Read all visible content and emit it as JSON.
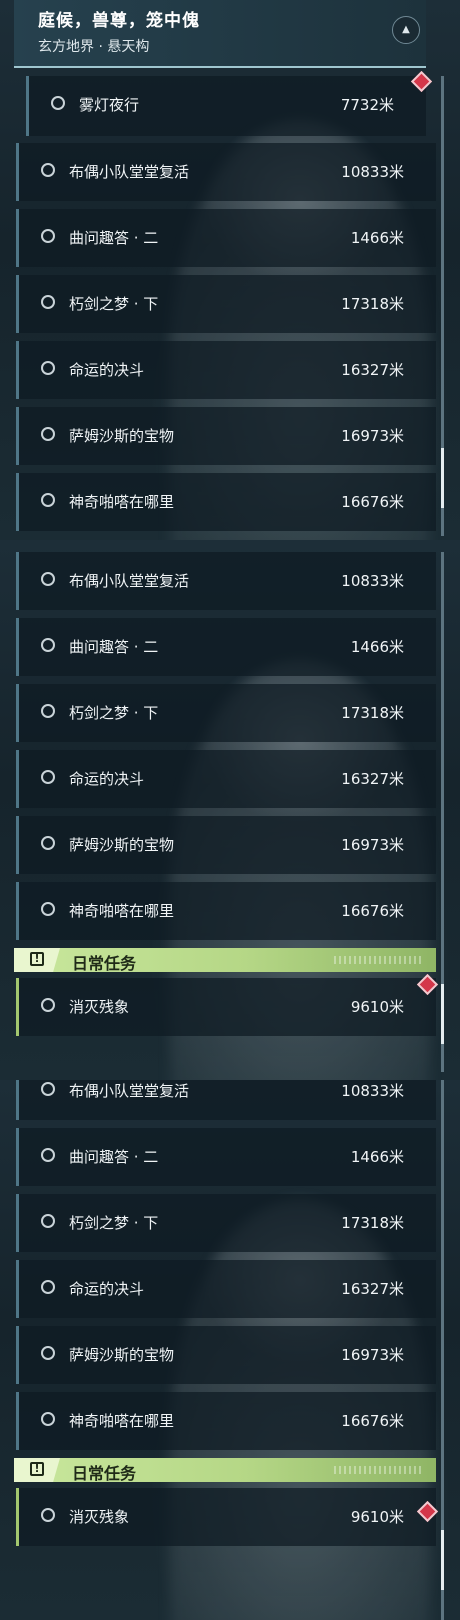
{
  "quest_title": "庭候，兽尊，笼中傀",
  "quest_area": "玄方地界 · 悬天构",
  "first_quest": {
    "name": "雾灯夜行",
    "distance": "7732米"
  },
  "quests": [
    {
      "name": "布偶小队堂堂复活",
      "distance": "10833米"
    },
    {
      "name": "曲问趣答 · 二",
      "distance": "1466米"
    },
    {
      "name": "朽剑之梦 · 下",
      "distance": "17318米"
    },
    {
      "name": "命运的决斗",
      "distance": "16327米"
    },
    {
      "name": "萨姆沙斯的宝物",
      "distance": "16973米"
    },
    {
      "name": "神奇啪嗒在哪里",
      "distance": "16676米"
    }
  ],
  "daily_section": {
    "label": "日常任务"
  },
  "daily_quest": {
    "name": "消灭残象",
    "distance": "9610米"
  },
  "icons": {
    "collapse": "chevron-up-icon",
    "quest_status": "radio-circle-icon",
    "tracking": "red-diamond-marker-icon",
    "section": "exclamation-icon"
  },
  "colors": {
    "accent_green": "#b5d786",
    "marker_red": "#d4374a",
    "row_border": "#4f7687"
  }
}
